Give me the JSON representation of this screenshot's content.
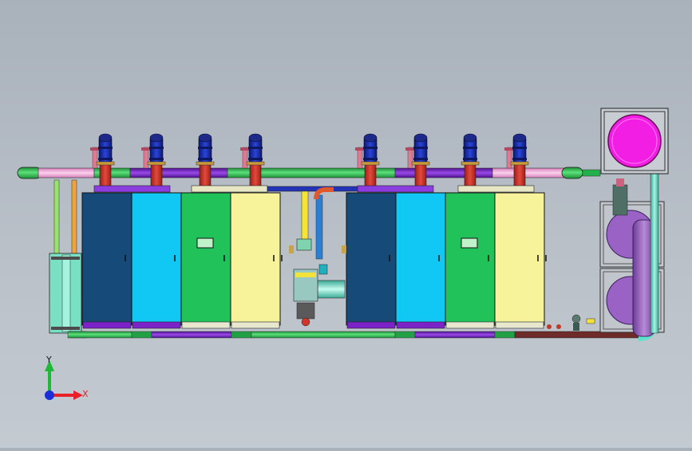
{
  "viewport": {
    "background_top": "#a9b1bb",
    "background_bottom": "#c4cad1"
  },
  "triad": {
    "x_label": "X",
    "y_label": "Y",
    "x_color": "#e8202a",
    "y_color": "#1fb93a",
    "z_color": "#1b2fd6"
  },
  "colors": {
    "cabinet_navy": "#164a78",
    "cabinet_cyan": "#11c8f4",
    "cabinet_green": "#22c25a",
    "cabinet_yellow": "#f6f39a",
    "pipe_green": "#29c44d",
    "pipe_purple": "#7b22c9",
    "pipe_pink": "#f2a9d8",
    "pipe_red": "#d0362c",
    "pipe_brown": "#6f2a2a",
    "pipe_teal": "#5fe0c9",
    "flue_blue": "#1a2ea8",
    "tank_magenta": "#f21ee4",
    "tank_purple": "#9a62c4"
  },
  "icons": [
    "axis-triad-icon",
    "panel-handle-icon",
    "control-display-icon",
    "valve-icon",
    "pump-icon",
    "flange-icon"
  ]
}
